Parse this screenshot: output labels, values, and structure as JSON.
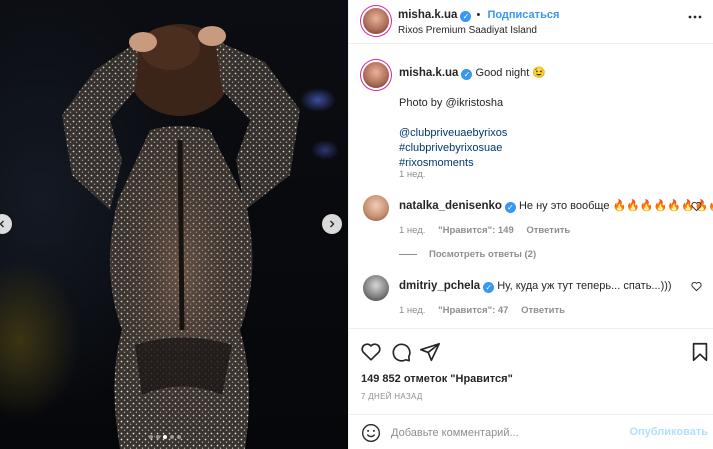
{
  "header": {
    "username": "misha.k.ua",
    "separator": "•",
    "follow_label": "Подписаться",
    "location": "Rixos Premium Saadiyat Island"
  },
  "caption": {
    "username": "misha.k.ua",
    "title": "Good night 😉",
    "photo_credit": "Photo by @ikristosha",
    "tags": [
      "@clubpriveuaebyrixos",
      "#clubprivebyrixosuae",
      "#rixosmoments"
    ],
    "time": "1 нед."
  },
  "comments": [
    {
      "username": "natalka_denisenko",
      "text": "Не ну это вообще 🔥🔥🔥🔥🔥🔥🔥🔥",
      "time": "1 нед.",
      "likes": "\"Нравится\": 149",
      "reply": "Ответить"
    },
    {
      "username": "dmitriy_pchela",
      "text": "Ну, куда уж тут теперь... спать...)))",
      "time": "1 нед.",
      "likes": "\"Нравится\": 47",
      "reply": "Ответить"
    }
  ],
  "view_replies": "Посмотреть ответы (2)",
  "likes_count": "149 852 отметок \"Нравится\"",
  "date": "7 ДНЕЙ НАЗАД",
  "add_comment": {
    "placeholder": "Добавьте комментарий...",
    "post_label": "Опубликовать"
  },
  "carousel": {
    "total": 5,
    "active_index": 2
  },
  "icons": [
    "chevron-left-icon",
    "chevron-right-icon",
    "more-icon",
    "heart-icon",
    "comment-icon",
    "share-icon",
    "bookmark-icon",
    "emoji-icon",
    "verified-icon"
  ],
  "colors": {
    "accent": "#3897f0",
    "link": "#00376b",
    "muted": "#8e8e8e",
    "post_disabled": "#b2dffc"
  }
}
